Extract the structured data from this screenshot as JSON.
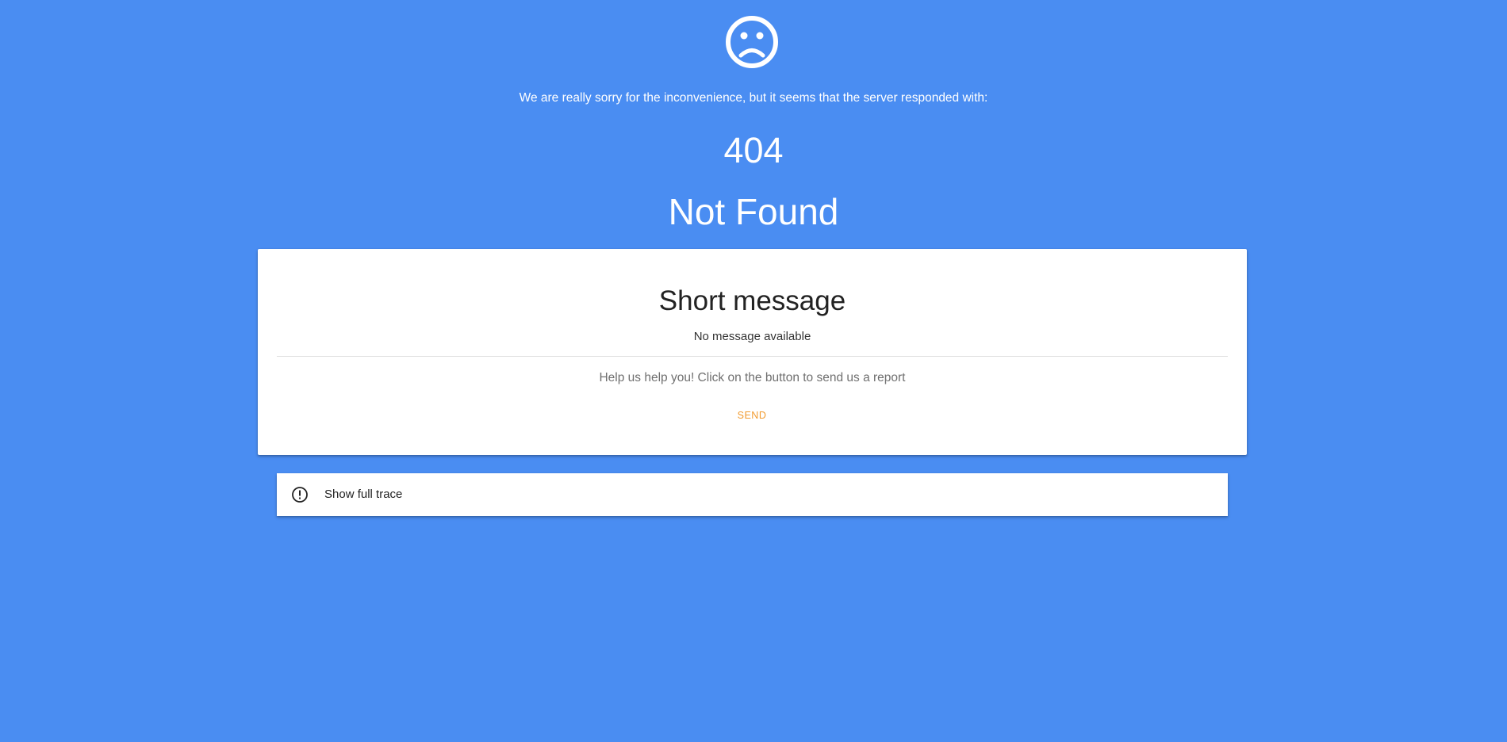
{
  "apology": "We are really sorry for the inconvenience, but it seems that the server responded with:",
  "status_code": "404",
  "status_text": "Not Found",
  "card": {
    "title": "Short message",
    "message": "No message available",
    "help_text": "Help us help you! Click on the button to send us a report",
    "send_label": "SEND"
  },
  "trace": {
    "label": "Show full trace"
  },
  "icons": {
    "header": "sad-face-icon",
    "trace": "exclamation-circle-icon"
  },
  "colors": {
    "background": "#4a8df2",
    "card": "#ffffff",
    "accent": "#f29b2f",
    "text_light": "#ffffff",
    "text_dark": "#222222",
    "text_muted": "#6f6f6f"
  }
}
